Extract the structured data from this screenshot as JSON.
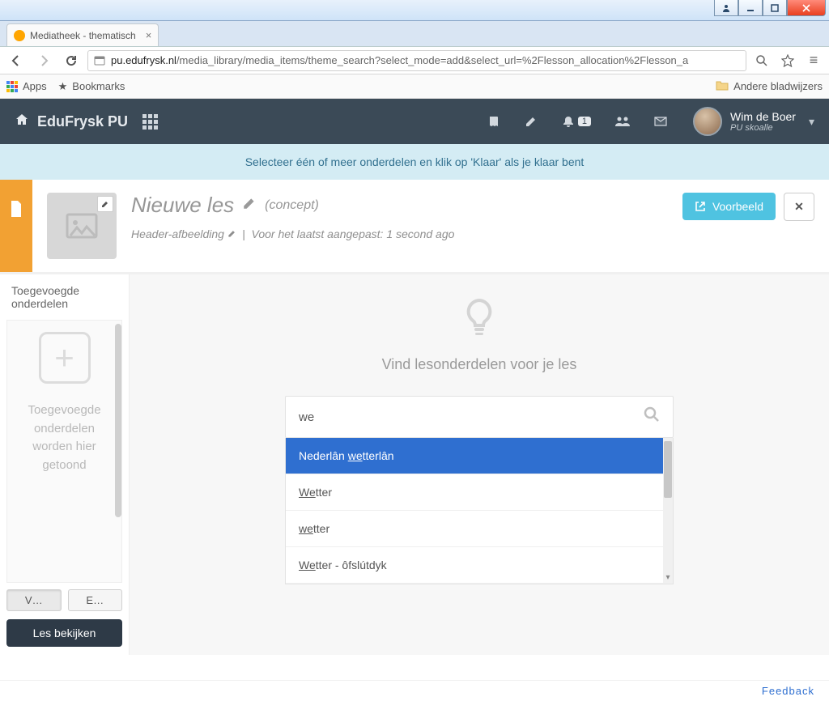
{
  "window": {
    "tab_title": "Mediatheek - thematisch"
  },
  "browser": {
    "url_host": "pu.edufrysk.nl",
    "url_path": "/media_library/media_items/theme_search?select_mode=add&select_url=%2Flesson_allocation%2Flesson_a",
    "bookmarks": {
      "apps": "Apps",
      "bookmarks": "Bookmarks",
      "other": "Andere bladwijzers"
    }
  },
  "nav": {
    "brand": "EduFrysk PU",
    "notification_count": "1",
    "user_name": "Wim de Boer",
    "user_sub": "PU skoalle"
  },
  "banner": {
    "text": "Selecteer één of meer onderdelen en klik op 'Klaar' als je klaar bent"
  },
  "header": {
    "title": "Nieuwe les",
    "concept": "(concept)",
    "sub_image": "Header-afbeelding",
    "sub_divider": "|",
    "sub_modified": "Voor het laatst aangepast: 1 second ago",
    "preview_btn": "Voorbeeld"
  },
  "sidebar": {
    "heading": "Toegevoegde onderdelen",
    "empty_msg": "Toegevoegde onderdelen worden hier getoond",
    "btn_v": "V…",
    "btn_e": "E…",
    "view_lesson": "Les bekijken"
  },
  "main": {
    "heading": "Vind lesonderdelen voor je les",
    "search_value": "we",
    "suggestions": [
      {
        "prefix": "Nederlân ",
        "match": "we",
        "suffix": "tterlân",
        "selected": true
      },
      {
        "prefix": "",
        "match": "We",
        "suffix": "tter",
        "selected": false
      },
      {
        "prefix": "",
        "match": "we",
        "suffix": "tter",
        "selected": false
      },
      {
        "prefix": "",
        "match": "We",
        "suffix": "tter - ôfslútdyk",
        "selected": false
      }
    ]
  },
  "footer": {
    "feedback": "Feedback"
  }
}
